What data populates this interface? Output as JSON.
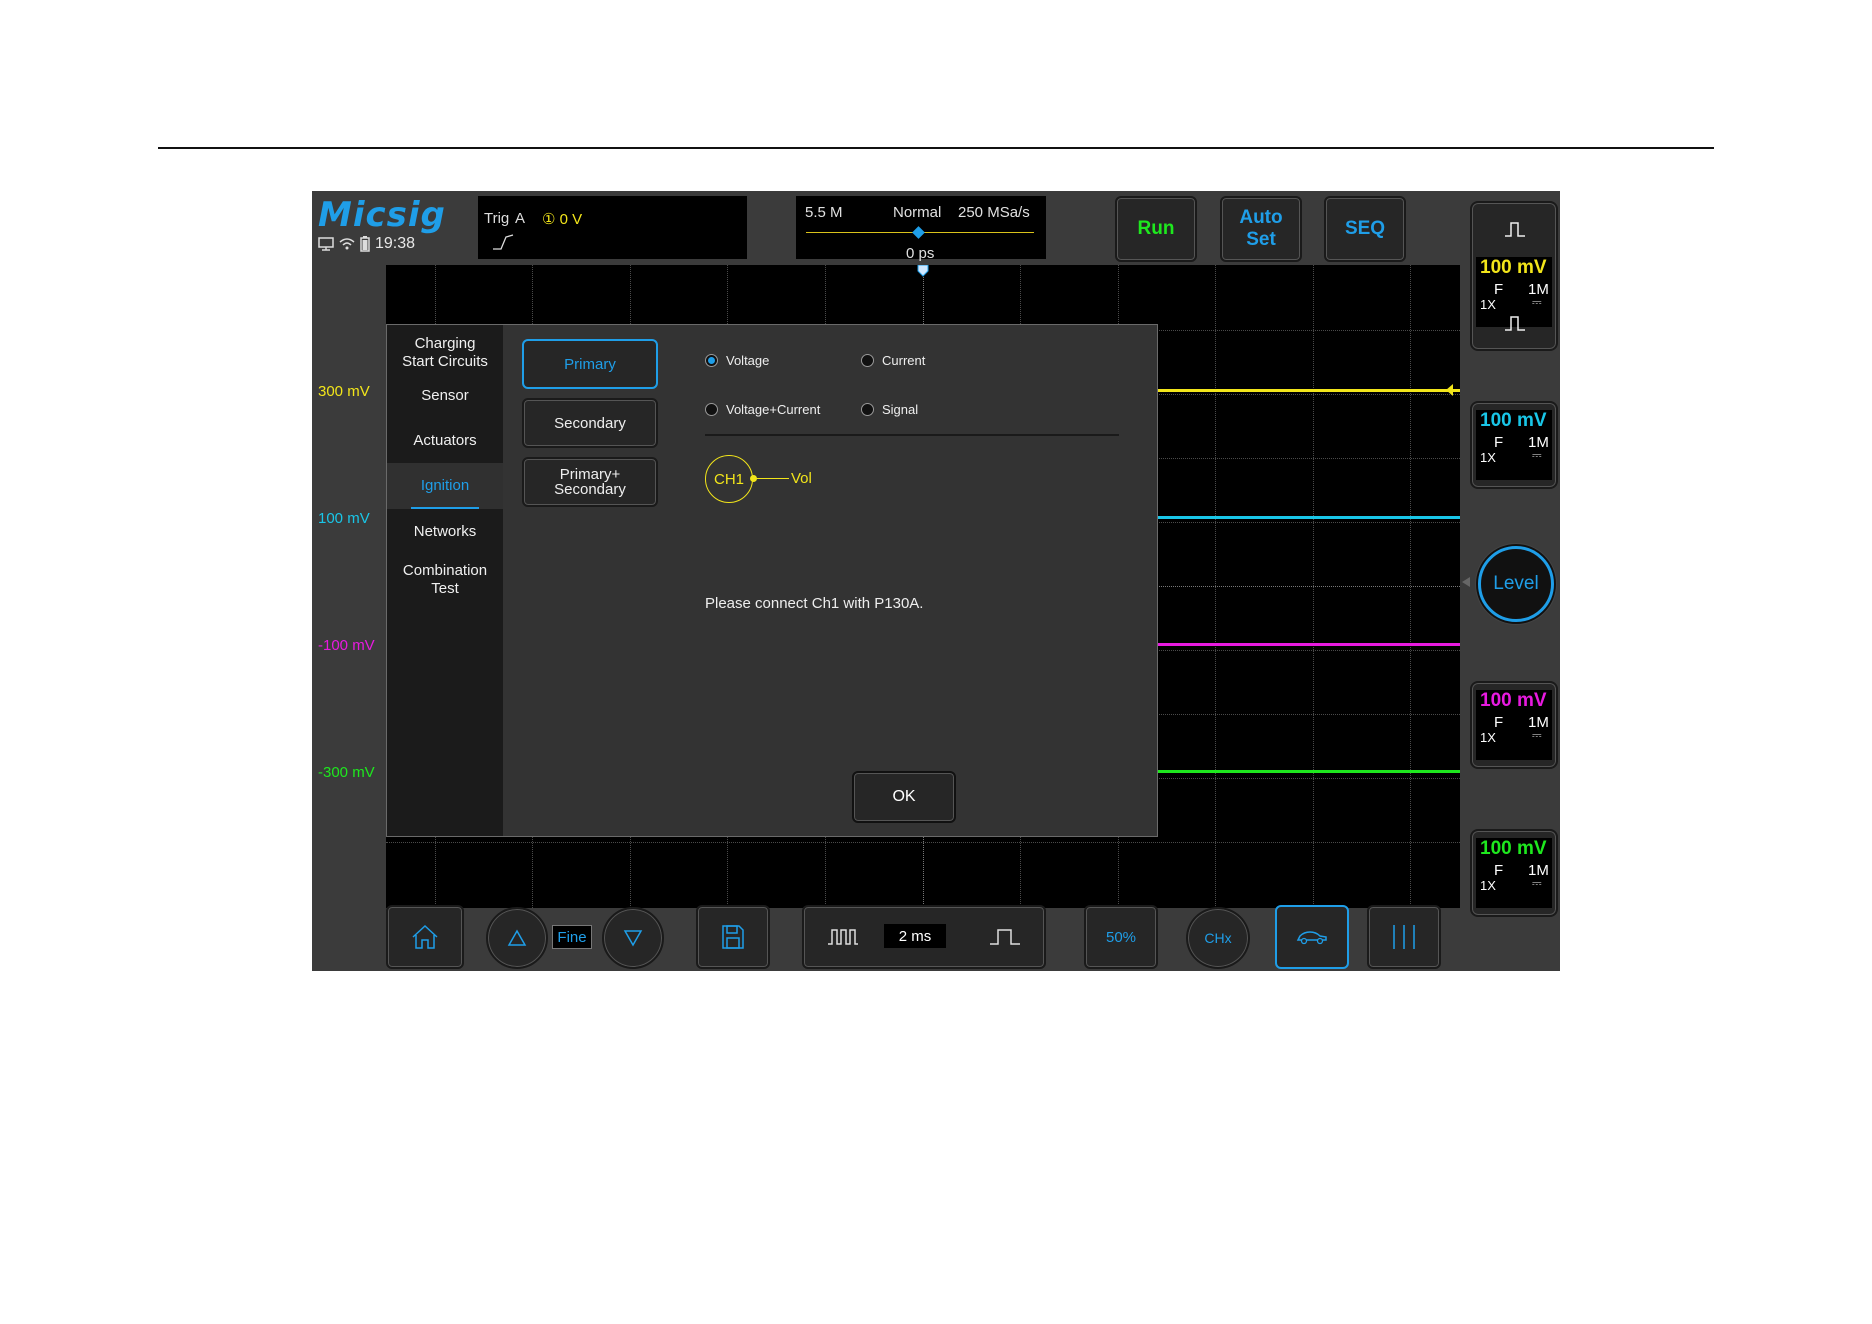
{
  "app": {
    "logo": "Micsig",
    "time": "19:38"
  },
  "trigger": {
    "label": "Trig",
    "source": "A",
    "level": "① 0 V"
  },
  "timebase": {
    "memory": "5.5 M",
    "mode": "Normal",
    "sample_rate": "250 MSa/s",
    "position": "0 ps"
  },
  "top_buttons": {
    "run": "Run",
    "auto_set_line1": "Auto",
    "auto_set_line2": "Set",
    "seq": "SEQ"
  },
  "y_labels": [
    {
      "text": "300 mV",
      "color": "#f2e51a"
    },
    {
      "text": "100 mV",
      "color": "#19c6e8"
    },
    {
      "text": "-100 mV",
      "color": "#e81ae0"
    },
    {
      "text": "-300 mV",
      "color": "#1ee81e"
    }
  ],
  "channels": [
    {
      "scale": "100 mV",
      "coupling": "F",
      "impedance": "1M",
      "probe": "1X",
      "dc": "⎓",
      "color": "#f2e51a"
    },
    {
      "scale": "100 mV",
      "coupling": "F",
      "impedance": "1M",
      "probe": "1X",
      "dc": "⎓",
      "color": "#19c6e8"
    },
    {
      "scale": "100 mV",
      "coupling": "F",
      "impedance": "1M",
      "probe": "1X",
      "dc": "⎓",
      "color": "#e81ae0"
    },
    {
      "scale": "100 mV",
      "coupling": "F",
      "impedance": "1M",
      "probe": "1X",
      "dc": "⎓",
      "color": "#1ee81e"
    }
  ],
  "level_button": "Level",
  "bottom": {
    "fine": "Fine",
    "timebase": "2 ms",
    "fifty": "50%",
    "hz": "CHx"
  },
  "dialog": {
    "menu": [
      {
        "line1": "Charging",
        "line2": "Start Circuits"
      },
      {
        "line1": "Sensor",
        "line2": ""
      },
      {
        "line1": "Actuators",
        "line2": ""
      },
      {
        "line1": "Ignition",
        "line2": ""
      },
      {
        "line1": "Networks",
        "line2": ""
      },
      {
        "line1": "Combination",
        "line2": "Test"
      }
    ],
    "types": [
      {
        "line1": "Primary",
        "line2": ""
      },
      {
        "line1": "Secondary",
        "line2": ""
      },
      {
        "line1": "Primary+",
        "line2": "Secondary"
      }
    ],
    "radios": {
      "voltage": "Voltage",
      "current": "Current",
      "voltage_current": "Voltage+Current",
      "signal": "Signal"
    },
    "channel": "CH1",
    "channel_label": "Vol",
    "message": "Please connect Ch1 with P130A.",
    "ok": "OK"
  }
}
